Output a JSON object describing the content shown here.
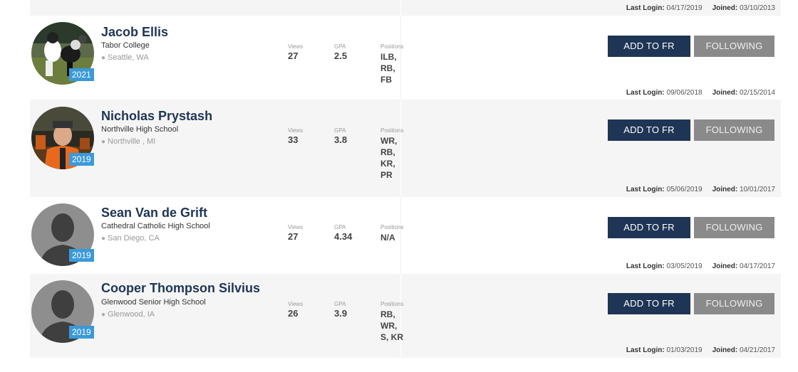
{
  "top_meta": {
    "last_login_label": "Last Login:",
    "last_login": "04/17/2019",
    "joined_label": "Joined:",
    "joined": "03/10/2013"
  },
  "labels": {
    "views": "Views",
    "gpa": "GPA",
    "positions": "Positions",
    "add_btn": "ADD TO FR",
    "follow_btn": "FOLLOWING",
    "last_login": "Last Login:",
    "joined": "Joined:"
  },
  "athletes": [
    {
      "name": "Jacob Ellis",
      "school": "Tabor College",
      "location": "Seattle, WA",
      "year": "2021",
      "views": "27",
      "gpa": "2.5",
      "positions": [
        "ILB,",
        "RB,",
        "FB"
      ],
      "last_login": "09/06/2018",
      "joined": "02/15/2014",
      "avatar": "football-action-photo"
    },
    {
      "name": "Nicholas Prystash",
      "school": "Northville High School",
      "location": "Northville , MI",
      "year": "2019",
      "views": "33",
      "gpa": "3.8",
      "positions": [
        "WR,",
        "RB,",
        "KR,",
        "PR"
      ],
      "last_login": "05/06/2019",
      "joined": "10/01/2017",
      "avatar": "player-portrait-photo"
    },
    {
      "name": "Sean Van de Grift",
      "school": "Cathedral Catholic High School",
      "location": "San Diego, CA",
      "year": "2019",
      "views": "27",
      "gpa": "4.34",
      "positions": [
        "N/A"
      ],
      "last_login": "03/05/2019",
      "joined": "04/17/2017",
      "avatar": "default-silhouette"
    },
    {
      "name": "Cooper Thompson Silvius",
      "school": "Glenwood Senior High School",
      "location": "Glenwood, IA",
      "year": "2019",
      "views": "26",
      "gpa": "3.9",
      "positions": [
        "RB,",
        "WR,",
        "S, KR"
      ],
      "last_login": "01/03/2019",
      "joined": "04/21/2017",
      "avatar": "default-silhouette"
    }
  ],
  "colors": {
    "navy": "#1f3556",
    "badge": "#3a9ad9",
    "follow": "#8a8a8a",
    "row_alt": "#f5f5f5"
  },
  "icons": {
    "location": "map-pin-icon"
  }
}
